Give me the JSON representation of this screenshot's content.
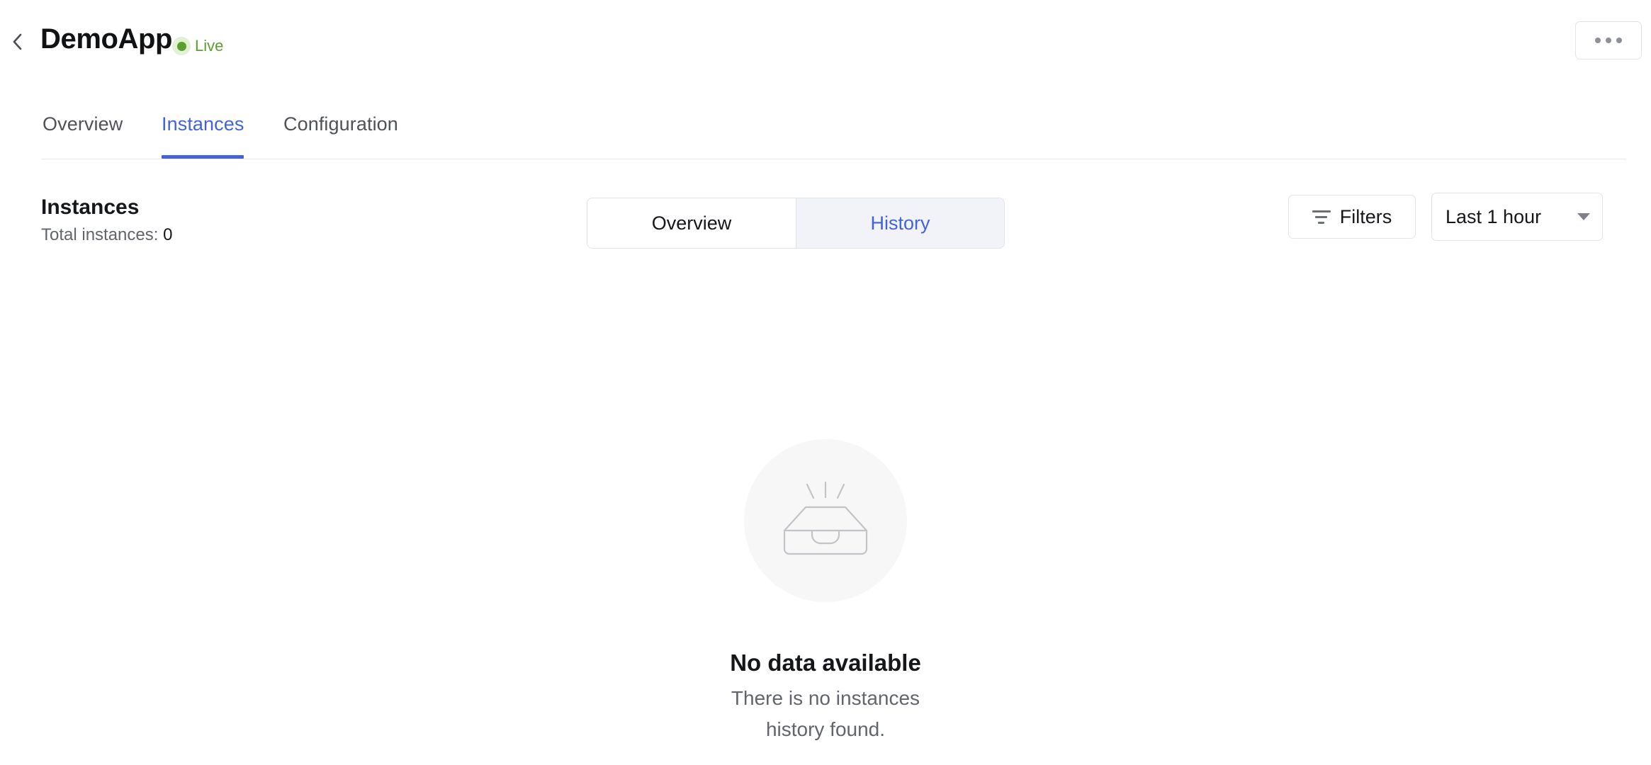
{
  "header": {
    "back_icon": "chevron-left-icon",
    "title": "DemoApp",
    "status": {
      "label": "Live",
      "dot_color": "#5d9e31",
      "halo_color": "#e2f0d4",
      "text_color": "#5d9e31"
    },
    "overflow_menu": {
      "icon": "ellipsis-horizontal-icon",
      "dot_color": "#8d9096"
    }
  },
  "tabs": {
    "items": [
      {
        "label": "Overview",
        "active": false
      },
      {
        "label": "Instances",
        "active": true
      },
      {
        "label": "Configuration",
        "active": false
      }
    ],
    "active_color": "#4264d8",
    "inactive_color": "#4f5257"
  },
  "toolbar": {
    "heading": "Instances",
    "total_label": "Total instances:",
    "total_value": "0",
    "segmented": {
      "options": [
        {
          "label": "Overview",
          "selected": false
        },
        {
          "label": "History",
          "selected": true
        }
      ],
      "selected_bg": "#f1f3f9",
      "selected_text": "#4264d8"
    },
    "filters": {
      "label": "Filters",
      "icon": "filter-icon"
    },
    "time_range": {
      "value": "Last 1 hour",
      "caret_icon": "caret-down-icon"
    }
  },
  "empty_state": {
    "illustration_icon": "empty-inbox-icon",
    "circle_color": "#f7f7f8",
    "title": "No data available",
    "subtitle": "There is no instances history found."
  }
}
